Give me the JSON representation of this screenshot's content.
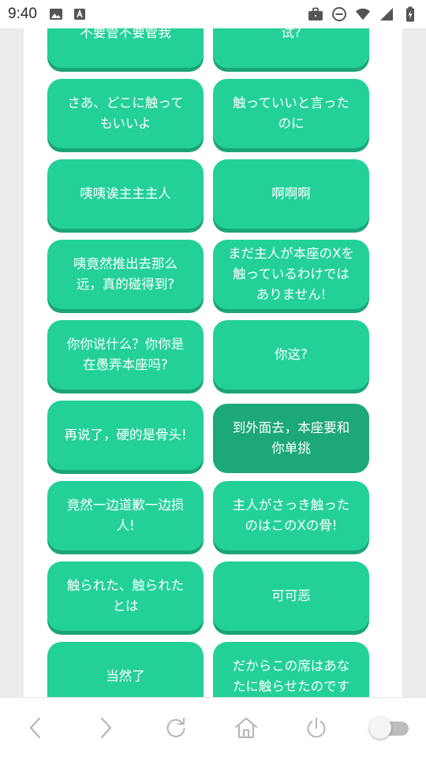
{
  "status_bar": {
    "time": "9:40",
    "left_icons": [
      "image-icon",
      "text-a-icon"
    ],
    "right_icons": [
      "briefcase-icon",
      "do-not-disturb-icon",
      "wifi-icon",
      "signal-icon",
      "battery-charging-icon"
    ]
  },
  "buttons": [
    {
      "label": "不要管不要管我",
      "selected": false
    },
    {
      "label": "试?",
      "selected": false
    },
    {
      "label": "さあ、どこに触ってもいいよ",
      "selected": false
    },
    {
      "label": "触っていいと言ったのに",
      "selected": false
    },
    {
      "label": "咦咦诶主主主人",
      "selected": false
    },
    {
      "label": "啊啊啊",
      "selected": false
    },
    {
      "label": "咦竟然推出去那么远，真的碰得到?",
      "selected": false
    },
    {
      "label": "まだ主人が本座のXを触っているわけではありません!",
      "selected": false
    },
    {
      "label": "你你说什么？你你是在愚弄本座吗?",
      "selected": false
    },
    {
      "label": "你这?",
      "selected": false
    },
    {
      "label": "再说了，硬的是骨头!",
      "selected": false
    },
    {
      "label": "到外面去，本座要和你单挑",
      "selected": true
    },
    {
      "label": "竟然一边道歉一边损人!",
      "selected": false
    },
    {
      "label": "主人がさっき触ったのはこのXの骨!",
      "selected": false
    },
    {
      "label": "触られた、触られたとは",
      "selected": false
    },
    {
      "label": "可可恶",
      "selected": false
    },
    {
      "label": "当然了",
      "selected": false
    },
    {
      "label": "だからこの席はあなたに触らせたのです",
      "selected": false
    }
  ],
  "bottom_nav": [
    "back-icon",
    "forward-icon",
    "reload-icon",
    "home-icon",
    "power-icon",
    "toggle-switch"
  ],
  "colors": {
    "bubble": "#23d198",
    "bubble_shadow": "#1ba477",
    "bubble_selected": "#1ca878"
  }
}
